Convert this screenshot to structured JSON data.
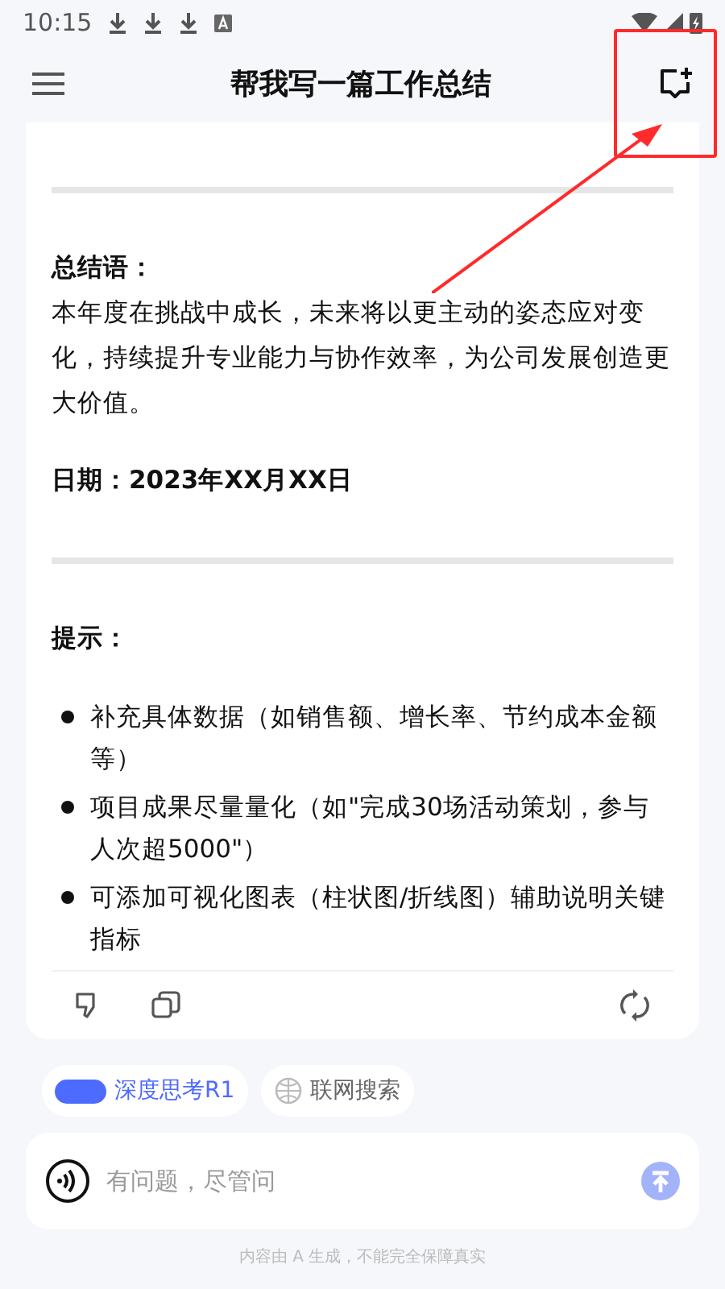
{
  "status_bar": {
    "time": "10:15"
  },
  "header": {
    "title": "帮我写一篇工作总结"
  },
  "message": {
    "summary_heading": "总结语：",
    "summary_text": "本年度在挑战中成长，未来将以更主动的姿态应对变化，持续提升专业能力与协作效率，为公司发展创造更大价值。",
    "date": "日期：2023年XX月XX日",
    "tips_heading": "提示：",
    "tips": [
      "补充具体数据（如销售额、增长率、节约成本金额等）",
      "项目成果尽量量化（如\"完成30场活动策划，参与人次超5000\"）",
      "可添加可视化图表（柱状图/折线图）辅助说明关键指标"
    ]
  },
  "modes": [
    {
      "label": "深度思考R1",
      "selected": true
    },
    {
      "label": "联网搜索",
      "selected": false
    }
  ],
  "input": {
    "placeholder": "有问题，尽管问"
  },
  "footer": "内容由 A 生成，不能完全保障真实"
}
